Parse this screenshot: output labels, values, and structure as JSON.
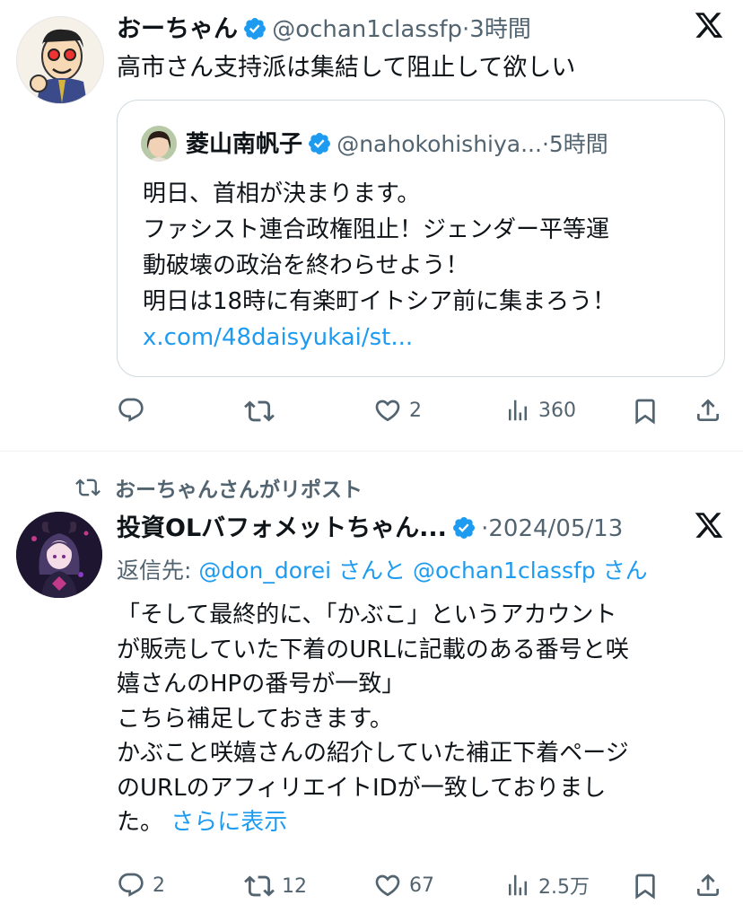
{
  "tweet1": {
    "author_name": "おーちゃん",
    "handle": "@ochan1classfp",
    "dot": "·",
    "time": "3時間",
    "text": "高市さん支持派は集結して阻止して欲しい",
    "quote": {
      "author_name": "菱山南帆子",
      "handle": "@nahokohishiya...",
      "dot": "·",
      "time": "5時間",
      "lines": [
        "明日、首相が決まります。",
        "ファシスト連合政権阻止！ジェンダー平等運",
        "動破壊の政治を終わらせよう！",
        "明日は18時に有楽町イトシア前に集まろう！"
      ],
      "link": "x.com/48daisyukai/st..."
    },
    "actions": {
      "reply_count": "",
      "repost_count": "",
      "like_count": "2",
      "view_count": "360"
    }
  },
  "tweet2": {
    "repost_label": "おーちゃんさんがリポスト",
    "author_name": "投資OLバフォメットちゃん...",
    "dot": "·",
    "time": "2024/05/13",
    "reply_prefix": "返信先: ",
    "reply_mention1": "@don_dorei",
    "reply_mid": " さんと ",
    "reply_mention2": "@ochan1classfp",
    "reply_suffix": " さん",
    "lines": [
      "「そして最終的に、「かぶこ」というアカウント",
      "が販売していた下着のURLに記載のある番号と咲",
      "嬉さんのHPの番号が一致」",
      "こちら補足しておきます。",
      "かぶこと咲嬉さんの紹介していた補正下着ページ",
      "のURLのアフィリエイトIDが一致しておりまし"
    ],
    "last_line": "た。",
    "show_more": "さらに表示",
    "actions": {
      "reply_count": "2",
      "repost_count": "12",
      "like_count": "67",
      "view_count": "2.5万"
    }
  },
  "colors": {
    "accent": "#1d9bf0",
    "secondary_text": "#536471",
    "primary_text": "#0f1419",
    "border": "#cfd9de"
  }
}
